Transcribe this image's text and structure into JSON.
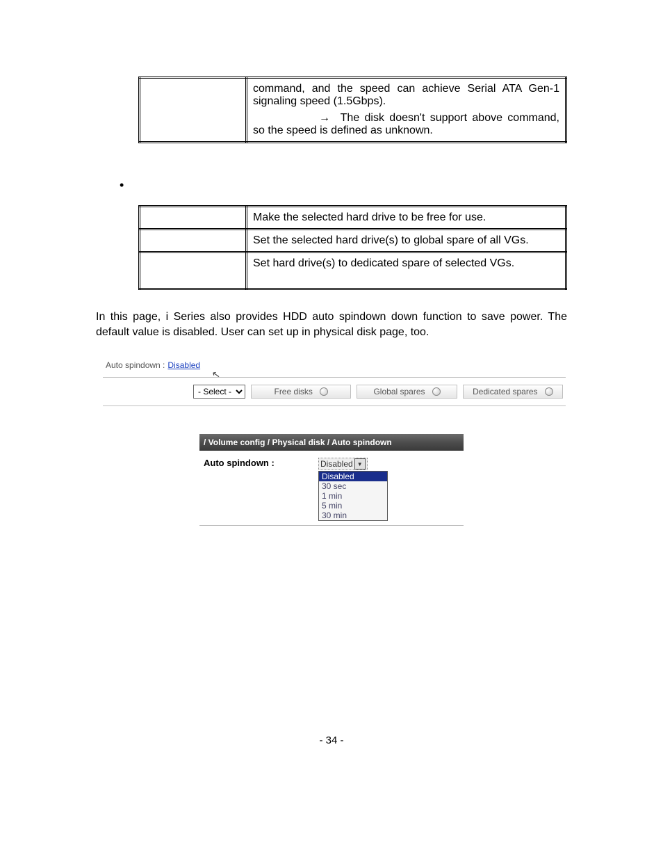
{
  "table1": {
    "cell_a": "command, and the speed can achieve Serial ATA Gen-1 signaling speed (1.5Gbps).",
    "arrow": "→",
    "cell_b": "The disk doesn't support above command, so the speed is defined as unknown."
  },
  "bullet": "•",
  "table2": {
    "r1": "Make the selected hard drive to be free for use.",
    "r2": "Set the selected hard drive(s) to global spare of all VGs.",
    "r3": "Set hard drive(s) to dedicated spare of selected VGs."
  },
  "paragraph": "In this page, i Series also provides HDD auto spindown down function to save power. The default value is disabled. User can set up in physical disk page, too.",
  "ui1": {
    "label": "Auto spindown :",
    "link": "Disabled",
    "select": "- Select -",
    "btn1": "Free disks",
    "btn2": "Global spares",
    "btn3": "Dedicated spares"
  },
  "ui2": {
    "crumb": "/ Volume config / Physical disk / Auto spindown",
    "label": "Auto spindown :",
    "selected": "Disabled",
    "options": [
      "Disabled",
      "30 sec",
      "1 min",
      "5 min",
      "30 min"
    ]
  },
  "pagenum": "- 34 -"
}
